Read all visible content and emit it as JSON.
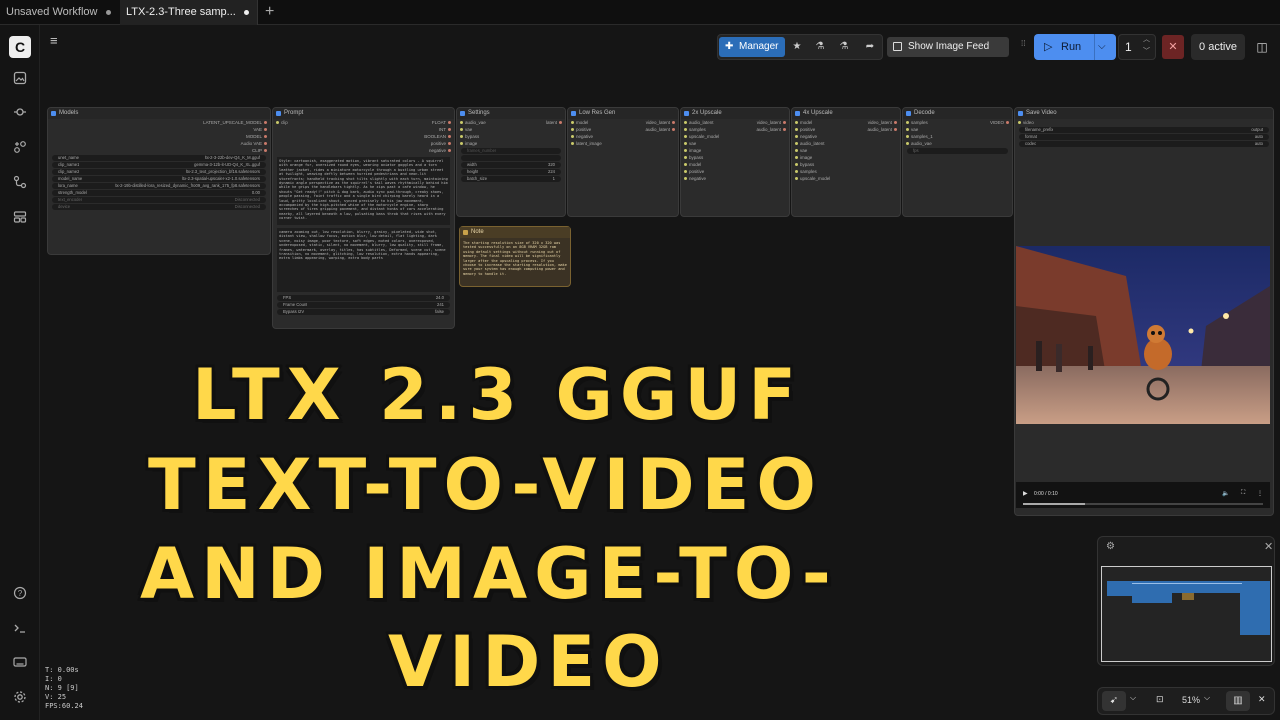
{
  "tabs": [
    {
      "label": "Unsaved Workflow"
    },
    {
      "label": "LTX-2.3-Three samp..."
    }
  ],
  "new_tab": "+",
  "sidebar": {
    "logo": "C",
    "icons": [
      "images-icon",
      "queue-icon",
      "node-library-icon",
      "workflows-icon",
      "templates-icon"
    ],
    "bottom": [
      "help-icon",
      "terminal-icon",
      "keyboard-icon",
      "settings-icon"
    ]
  },
  "menu_icon": "≡",
  "topbar": {
    "manager": "Manager",
    "show_feed": "Show Image Feed",
    "run": "Run",
    "run_count": "1",
    "stop": "✕",
    "active": "0 active"
  },
  "nodes": {
    "models": {
      "title": "Models",
      "outputs": [
        "LATENT_UPSCALE_MODEL",
        "VAE",
        "MODEL",
        "Audio VAE",
        "CLIP"
      ],
      "widgets": [
        [
          "unet_name",
          "ltx-2-3-22b-dev-Q4_K_M.gguf"
        ],
        [
          "clip_name1",
          "gemma-3-12b-it-UD-Q4_K_XL.gguf"
        ],
        [
          "clip_name2",
          "ltx-2.3_text_projection_bf16.safetensors"
        ],
        [
          "model_name",
          "ltx-2.3-spatial-upscaler-x2-1.0.safetensors"
        ],
        [
          "lora_name",
          "ltx-2-19b-distilled-lora_resized_dynamic_fro09_avg_rank_175_fp8.safetensors"
        ],
        [
          "strength_model",
          "0.00"
        ],
        [
          "text_encoder",
          "Disconnected"
        ],
        [
          "device",
          "Disconnected"
        ]
      ]
    },
    "prompt": {
      "title": "Prompt",
      "inputs": [
        "clip"
      ],
      "outputs": [
        "FLOAT",
        "INT",
        "BOOLEAN",
        "positive",
        "negative"
      ],
      "positive_text": "Style: cartoonish, exaggerated motion, vibrant saturated colors - A squirrel with orange fur, oversized round eyes, wearing aviator goggles and a torn leather jacket, rides a miniature motorcycle through a bustling urban street at twilight, weaving deftly between hurried pedestrians and neon-lit storefronts; handheld tracking shot tilts slightly with each turn, maintaining dynamic angle perspective as the squirrel's tail waves rhythmically behind him while he grips the handlebars tightly. As he zips past a cafe window, he shouts \"Get ready!!\" pitch & dog bark, audio sync pad-through, creaky shoes, people passing, faint traffic and a single bird chirping barely heard in a loud, gritty localized shout, synced precisely to his jaw movement, accompanied by the high-pitched whine of the motorcycle engine, sharp screeches of tires gripping pavement, and distant honks of cars accelerating nearby, all layered beneath a low, pulsating bass throb that rises with every corner twist.",
      "negative_text": "camera zooming out, low resolution, blurry, grainy, pixelated, wide shot, distant view, shallow focus, motion blur, low detail, flat lighting, dark scene, noisy image, poor texture, soft edges, muted colors, overexposed, underexposed, static, silent, no movement, blurry, low quality, still frame, frames, watermark, overlay, titles, has subtitles, Deformed, scene cut, scene transition, no movement, glitching, low resolution, extra hands appearing, extra limbs appearing, warping, extra body parts",
      "widgets": [
        [
          "FPS",
          "24.0"
        ],
        [
          "Frame Count",
          "241"
        ],
        [
          "Bypass I2V",
          "false"
        ]
      ]
    },
    "settings": {
      "title": "Settings",
      "inputs": [
        "audio_vae",
        "vae",
        "bypass",
        "image"
      ],
      "outputs": [
        "latent"
      ],
      "widgets": [
        [
          "frames_number",
          ""
        ],
        [
          "",
          ""
        ],
        [
          "width",
          "320"
        ],
        [
          "height",
          "224"
        ],
        [
          "batch_size",
          "1"
        ]
      ]
    },
    "lowres": {
      "title": "Low Res Gen",
      "inputs": [
        "model",
        "positive",
        "negative",
        "latent_image"
      ],
      "outputs": [
        "video_latent",
        "audio_latent"
      ]
    },
    "up2x": {
      "title": "2x Upscale",
      "inputs": [
        "audio_latent",
        "samples",
        "upscale_model",
        "vae",
        "image",
        "bypass",
        "model",
        "positive",
        "negative"
      ],
      "outputs": [
        "video_latent",
        "audio_latent"
      ]
    },
    "up4x": {
      "title": "4x Upscale",
      "inputs": [
        "model",
        "positive",
        "negative",
        "audio_latent",
        "vae",
        "image",
        "bypass",
        "samples",
        "upscale_model"
      ],
      "outputs": [
        "video_latent",
        "audio_latent"
      ]
    },
    "decode": {
      "title": "Decode",
      "inputs": [
        "samples",
        "vae",
        "samples_1",
        "audio_vae"
      ],
      "outputs": [
        "VIDEO"
      ],
      "widgets": [
        [
          "fps",
          ""
        ]
      ]
    },
    "save": {
      "title": "Save Video",
      "inputs": [
        "video"
      ],
      "widgets": [
        [
          "filename_prefix",
          "output"
        ],
        [
          "format",
          "auto"
        ],
        [
          "codec",
          "auto"
        ]
      ],
      "time": "0:00 / 0:10"
    },
    "note": {
      "title": "Note",
      "text": "The starting resolution size of 320 x 320 was tested successfully on an 8GB VRAM 32GB ram using default settings without running out of memory. The final video will be significantly larger after the upscaling process. If you choose to increase the starting resolution, make sure your system has enough computing power and memory to handle it."
    }
  },
  "zoom": "51%",
  "stats": [
    "T: 0.00s",
    "I: 0",
    "N: 9 [9]",
    "V: 25",
    "FPS:60.24"
  ],
  "overlay": [
    "LTX 2.3 GGUF",
    "TEXT-TO-VIDEO",
    "AND IMAGE-TO-",
    "VIDEO"
  ],
  "colors": {
    "accent": "#4d8ef0",
    "title_yellow": "#ffd84a"
  }
}
